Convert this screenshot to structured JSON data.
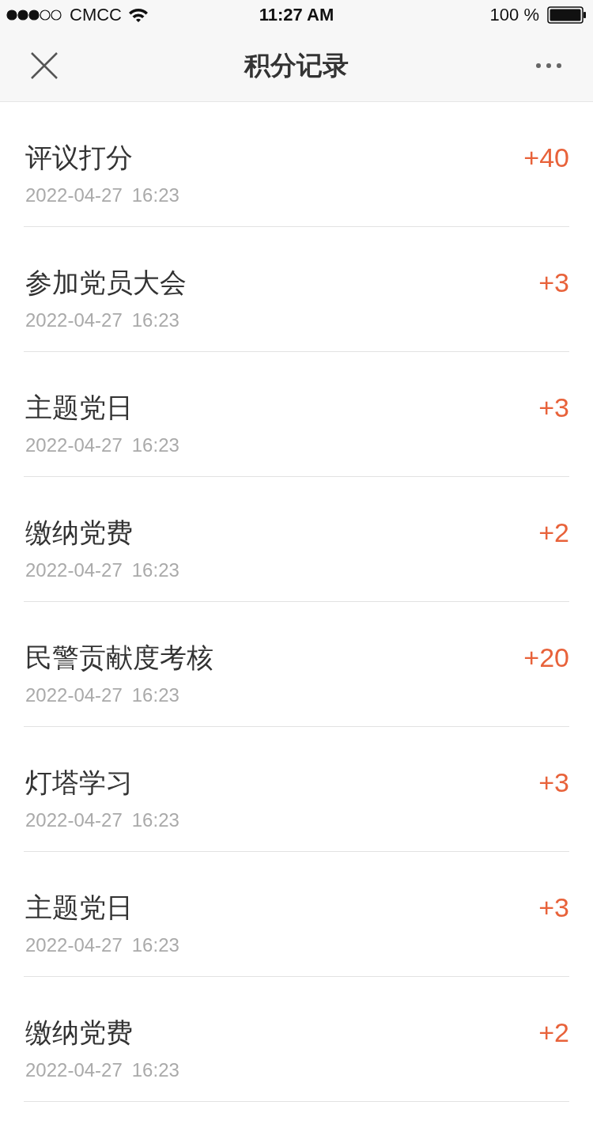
{
  "status_bar": {
    "carrier": "CMCC",
    "time": "11:27 AM",
    "battery": "100 %"
  },
  "nav": {
    "title": "积分记录"
  },
  "records": [
    {
      "title": "评议打分",
      "date": "2022-04-27",
      "time": "16:23",
      "points": "+40"
    },
    {
      "title": "参加党员大会",
      "date": "2022-04-27",
      "time": "16:23",
      "points": "+3"
    },
    {
      "title": "主题党日",
      "date": "2022-04-27",
      "time": "16:23",
      "points": "+3"
    },
    {
      "title": "缴纳党费",
      "date": "2022-04-27",
      "time": "16:23",
      "points": "+2"
    },
    {
      "title": "民警贡献度考核",
      "date": "2022-04-27",
      "time": "16:23",
      "points": "+20"
    },
    {
      "title": "灯塔学习",
      "date": "2022-04-27",
      "time": "16:23",
      "points": "+3"
    },
    {
      "title": "主题党日",
      "date": "2022-04-27",
      "time": "16:23",
      "points": "+3"
    },
    {
      "title": "缴纳党费",
      "date": "2022-04-27",
      "time": "16:23",
      "points": "+2"
    }
  ]
}
